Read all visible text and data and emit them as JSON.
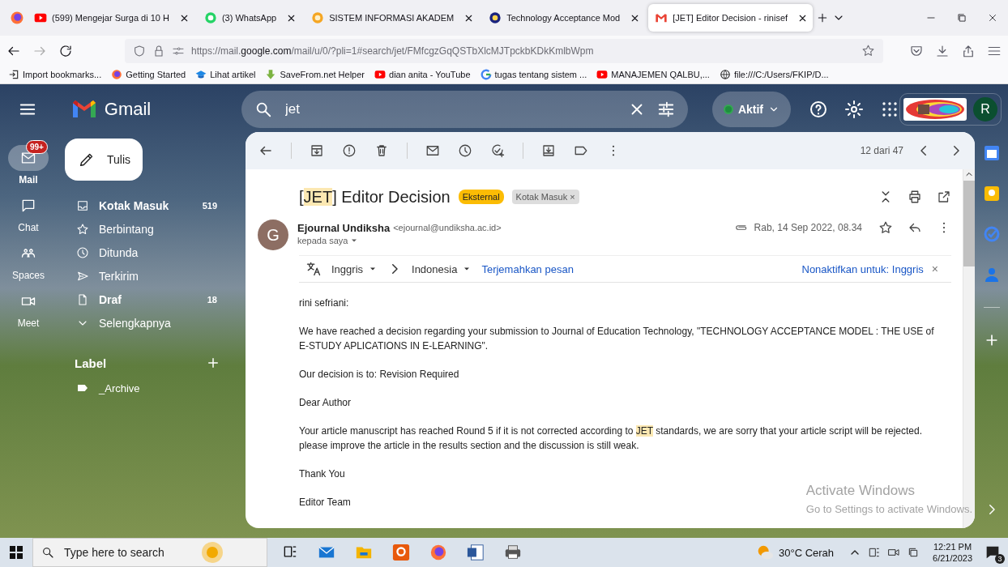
{
  "browser": {
    "tabs": [
      {
        "title": "(599) Mengejar Surga di 10 H",
        "kind": "youtube",
        "selected": false
      },
      {
        "title": "(3) WhatsApp",
        "kind": "whatsapp",
        "selected": false
      },
      {
        "title": "SISTEM INFORMASI AKADEM",
        "kind": "portal",
        "selected": false
      },
      {
        "title": "Technology Acceptance Mod",
        "kind": "journal",
        "selected": false
      },
      {
        "title": "[JET] Editor Decision - rinisef",
        "kind": "gmail",
        "selected": true
      }
    ],
    "url": "https://mail.**google.com**/mail/u/0/?pli=1#search/jet/FMfcgzGqQSTbXlcMJTpckbKDkKmlbWpm",
    "bookmarks": [
      {
        "label": "Import bookmarks...",
        "kind": "import"
      },
      {
        "label": "Getting Started",
        "kind": "firefox"
      },
      {
        "label": "Lihat artikel",
        "kind": "cap"
      },
      {
        "label": "SaveFrom.net Helper",
        "kind": "download"
      },
      {
        "label": "dian anita - YouTube",
        "kind": "youtube"
      },
      {
        "label": "tugas tentang sistem ...",
        "kind": "google"
      },
      {
        "label": "MANAJEMEN QALBU,...",
        "kind": "youtube"
      },
      {
        "label": "file:///C:/Users/FKIP/D...",
        "kind": "globe"
      }
    ]
  },
  "gmail": {
    "app_name": "Gmail",
    "search": {
      "value": "jet"
    },
    "status": "Aktif",
    "avatar": "R",
    "rail": [
      {
        "label": "Mail",
        "kind": "mail",
        "selected": true,
        "badge": "99+"
      },
      {
        "label": "Chat",
        "kind": "chat",
        "selected": false
      },
      {
        "label": "Spaces",
        "kind": "spaces",
        "selected": false
      },
      {
        "label": "Meet",
        "kind": "meet",
        "selected": false
      }
    ],
    "compose": "Tulis",
    "folders": [
      {
        "label": "Kotak Masuk",
        "kind": "inbox",
        "unread": true,
        "count": "519"
      },
      {
        "label": "Berbintang",
        "kind": "star",
        "unread": false
      },
      {
        "label": "Ditunda",
        "kind": "clock",
        "unread": false
      },
      {
        "label": "Terkirim",
        "kind": "send",
        "unread": false
      },
      {
        "label": "Draf",
        "kind": "draft",
        "unread": true,
        "count": "18"
      },
      {
        "label": "Selengkapnya",
        "kind": "more",
        "unread": false
      }
    ],
    "labels_heading": "Label",
    "labels": [
      {
        "name": "_Archive"
      }
    ]
  },
  "message": {
    "counter": "12 dari 47",
    "subject": [
      {
        "text": "[",
        "highlighted": false
      },
      {
        "text": "JET",
        "highlighted": true
      },
      {
        "text": "] Editor Decision",
        "highlighted": false
      }
    ],
    "tags": [
      {
        "label": "Eksternal",
        "kind": "external"
      },
      {
        "label": "Kotak Masuk",
        "kind": "folder",
        "close": "×"
      }
    ],
    "sender": {
      "initial": "G",
      "name": "Ejournal Undiksha",
      "email": "<ejournal@undiksha.ac.id>",
      "recipient": "kepada saya",
      "date": "Rab, 14 Sep 2022, 08.34"
    },
    "translate": {
      "from": "Inggris",
      "to": "Indonesia",
      "action": "Terjemahkan pesan",
      "disable": "Nonaktifkan untuk: Inggris",
      "close": "×"
    },
    "body": [
      {
        "parts": [
          {
            "text": "rini sefriani:",
            "highlighted": false
          }
        ]
      },
      {
        "parts": [
          {
            "text": "We have reached a decision regarding your submission to Journal of Education Technology, \"TECHNOLOGY ACCEPTANCE MODEL : THE USE of\nE-STUDY APLICATIONS IN E-LEARNING\".",
            "highlighted": false
          }
        ]
      },
      {
        "parts": [
          {
            "text": "Our decision is to: Revision Required",
            "highlighted": false
          }
        ]
      },
      {
        "parts": [
          {
            "text": "Dear Author",
            "highlighted": false
          }
        ]
      },
      {
        "parts": [
          {
            "text": "Your article manuscript has reached Round 5 if it is not corrected according to ",
            "highlighted": false
          },
          {
            "text": "JET",
            "highlighted": true
          },
          {
            "text": " standards, we are sorry that your article script will be rejected.\nplease improve the article in the results section and the discussion is still weak.",
            "highlighted": false
          }
        ]
      },
      {
        "parts": [
          {
            "text": "Thank You",
            "highlighted": false
          }
        ]
      },
      {
        "parts": [
          {
            "text": "Editor Team",
            "highlighted": false
          }
        ]
      }
    ]
  },
  "watermark": {
    "title": "Activate Windows",
    "subtitle": "Go to Settings to activate Windows."
  },
  "taskbar": {
    "search_placeholder": "Type here to search",
    "weather": "30°C Cerah",
    "time": "12:21 PM",
    "date": "6/21/2023",
    "notifications": "3"
  }
}
